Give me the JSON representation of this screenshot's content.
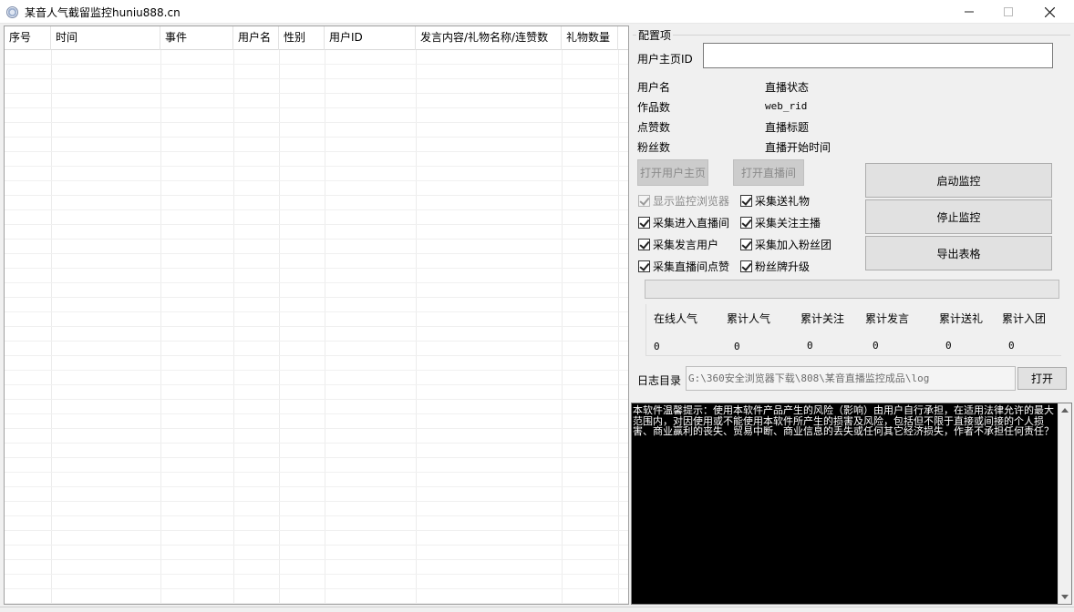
{
  "window": {
    "title": "某音人气截留监控huniu888.cn",
    "minimize_icon": "minimize-icon",
    "maximize_icon": "maximize-icon",
    "close_icon": "close-icon"
  },
  "table": {
    "columns": [
      "序号",
      "时间",
      "事件",
      "用户名",
      "性别",
      "用户ID",
      "发言内容/礼物名称/连赞数",
      "礼物数量"
    ],
    "rows": []
  },
  "config": {
    "group_title": "配置项",
    "homepage_id_label": "用户主页ID",
    "homepage_id_value": "",
    "info_labels_left": [
      "用户名",
      "作品数",
      "点赞数",
      "粉丝数"
    ],
    "info_labels_right": [
      "直播状态",
      "web_rid",
      "直播标题",
      "直播开始时间"
    ],
    "open_homepage_button": "打开用户主页",
    "open_live_button": "打开直播间",
    "start_button": "启动监控",
    "stop_button": "停止监控",
    "export_button": "导出表格",
    "checkboxes": [
      {
        "label": "显示监控浏览器",
        "checked": true,
        "disabled": true
      },
      {
        "label": "采集送礼物",
        "checked": true,
        "disabled": false
      },
      {
        "label": "采集进入直播间",
        "checked": true,
        "disabled": false
      },
      {
        "label": "采集关注主播",
        "checked": true,
        "disabled": false
      },
      {
        "label": "采集发言用户",
        "checked": true,
        "disabled": false
      },
      {
        "label": "采集加入粉丝团",
        "checked": true,
        "disabled": false
      },
      {
        "label": "采集直播间点赞",
        "checked": true,
        "disabled": false
      },
      {
        "label": "粉丝牌升级",
        "checked": true,
        "disabled": false
      }
    ],
    "progress": 0
  },
  "stats": {
    "labels": [
      "在线人气",
      "累计人气",
      "累计关注",
      "累计发言",
      "累计送礼",
      "累计入团"
    ],
    "values": [
      "0",
      "0",
      "0",
      "0",
      "0",
      "0"
    ]
  },
  "log": {
    "label": "日志目录",
    "path": "G:\\360安全浏览器下载\\808\\某音直播监控成品\\log",
    "open_button": "打开"
  },
  "console": {
    "text": "本软件温馨提示：使用本软件产品产生的风险（影响）由用户自行承担，在适用法律允许的最大范围内，对因使用或不能使用本软件所产生的损害及风险，包括但不限于直接或间接的个人损害、商业赢利的丧失、贸易中断、商业信息的丢失或任何其它经济损失，作者不承担任何责任？"
  }
}
